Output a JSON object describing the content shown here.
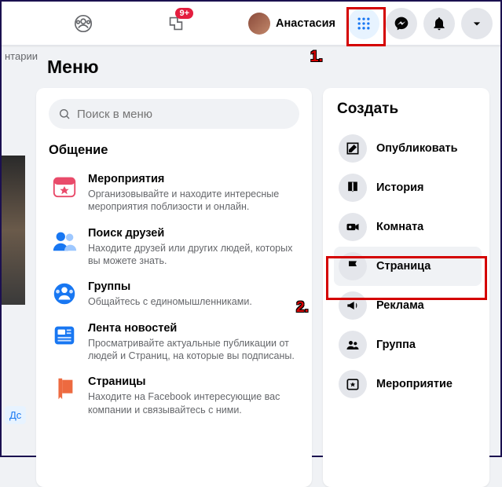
{
  "topbar": {
    "groups_icon": "groups-icon",
    "gaming_icon": "gaming-icon",
    "gaming_badge": "9+",
    "profile_name": "Анастасия",
    "menu_icon": "apps-grid-icon",
    "messenger_icon": "messenger-icon",
    "notifications_icon": "bell-icon",
    "account_icon": "caret-down-icon"
  },
  "sliver": {
    "text_fragment": "нтарии",
    "button_fragment": "Дс"
  },
  "menu": {
    "title": "Меню",
    "search_placeholder": "Поиск в меню",
    "section_title": "Общение",
    "items": [
      {
        "icon": "events-icon",
        "title": "Мероприятия",
        "desc": "Организовывайте и находите интересные мероприятия поблизости и онлайн."
      },
      {
        "icon": "find-friends-icon",
        "title": "Поиск друзей",
        "desc": "Находите друзей или других людей, которых вы можете знать."
      },
      {
        "icon": "groups-color-icon",
        "title": "Группы",
        "desc": "Общайтесь с единомышленниками."
      },
      {
        "icon": "news-feed-icon",
        "title": "Лента новостей",
        "desc": "Просматривайте актуальные публикации от людей и Страниц, на которые вы подписаны."
      },
      {
        "icon": "pages-icon",
        "title": "Страницы",
        "desc": "Находите на Facebook интересующие вас компании и связывайтесь с ними."
      }
    ]
  },
  "create": {
    "title": "Создать",
    "items": [
      {
        "icon": "compose-icon",
        "label": "Опубликовать",
        "selected": false
      },
      {
        "icon": "story-icon",
        "label": "История",
        "selected": false
      },
      {
        "icon": "room-icon",
        "label": "Комната",
        "selected": false
      },
      {
        "icon": "page-flag-icon",
        "label": "Страница",
        "selected": true
      },
      {
        "icon": "ad-megaphone-icon",
        "label": "Реклама",
        "selected": false
      },
      {
        "icon": "group-icon",
        "label": "Группа",
        "selected": false
      },
      {
        "icon": "event-star-icon",
        "label": "Мероприятие",
        "selected": false
      }
    ]
  },
  "annotations": {
    "label1": "1.",
    "label2": "2."
  }
}
